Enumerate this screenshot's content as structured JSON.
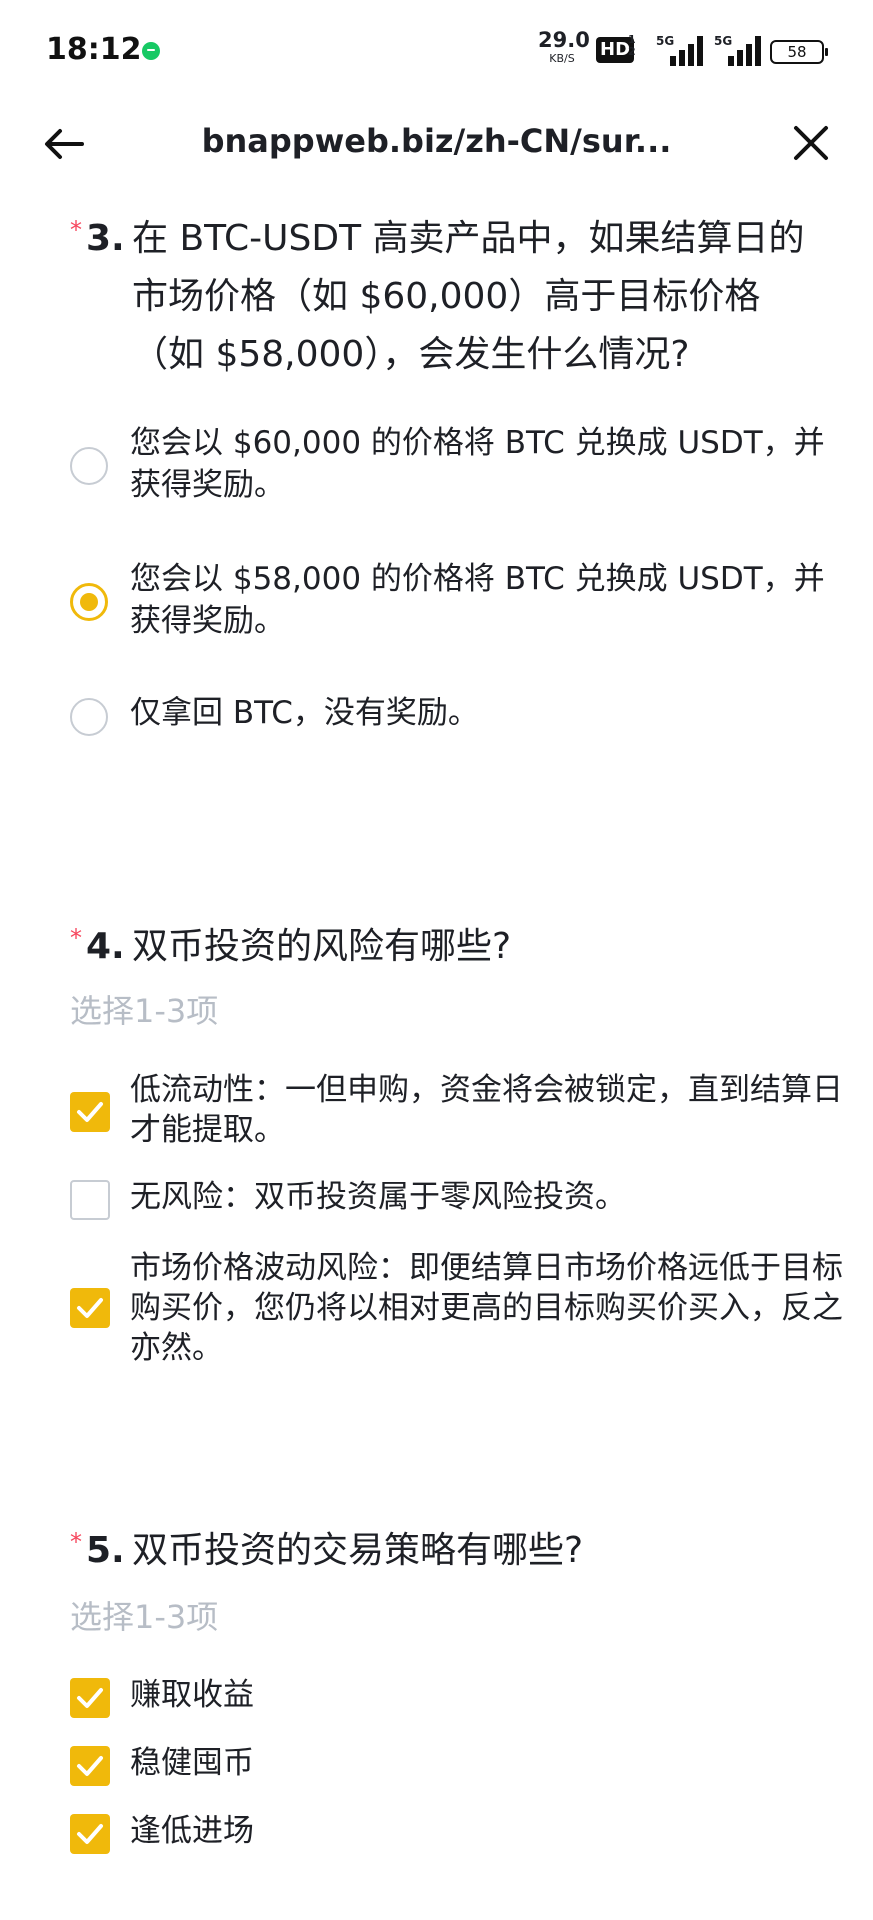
{
  "status_bar": {
    "time": "18:12",
    "net_speed_value": "29.0",
    "net_speed_unit": "KB/S",
    "hd_label": "HD",
    "hd_sub": "1\n2",
    "signal_label_1": "5G",
    "signal_label_2": "5G",
    "battery": "58"
  },
  "nav": {
    "url": "bnappweb.biz/zh-CN/sur..."
  },
  "questions": [
    {
      "number": "3.",
      "title": "在 BTC-USDT 高卖产品中，如果结算日的市场价格（如 $60,000）高于目标价格（如 $58,000），会发生什么情况?",
      "options": [
        {
          "label": "您会以 $60,000 的价格将 BTC 兑换成 USDT，并获得奖励。",
          "selected": false
        },
        {
          "label": "您会以 $58,000 的价格将 BTC 兑换成 USDT，并获得奖励。",
          "selected": true
        },
        {
          "label": "仅拿回 BTC，没有奖励。",
          "selected": false
        }
      ]
    },
    {
      "number": "4.",
      "title": "双币投资的风险有哪些?",
      "hint": "选择1-3项",
      "options": [
        {
          "label": "低流动性：一但申购，资金将会被锁定，直到结算日才能提取。",
          "checked": true
        },
        {
          "label": "无风险：双币投资属于零风险投资。",
          "checked": false
        },
        {
          "label": "市场价格波动风险：即便结算日市场价格远低于目标购买价，您仍将以相对更高的目标购买价买入，反之亦然。",
          "checked": true
        }
      ]
    },
    {
      "number": "5.",
      "title": "双币投资的交易策略有哪些?",
      "hint": "选择1-3项",
      "options": [
        {
          "label": "赚取收益",
          "checked": true
        },
        {
          "label": "稳健囤币",
          "checked": true
        },
        {
          "label": "逢低进场",
          "checked": true
        }
      ]
    }
  ],
  "colors": {
    "accent": "#f0b90b",
    "required_star": "#f6465d",
    "hint": "#b7bdc6"
  }
}
